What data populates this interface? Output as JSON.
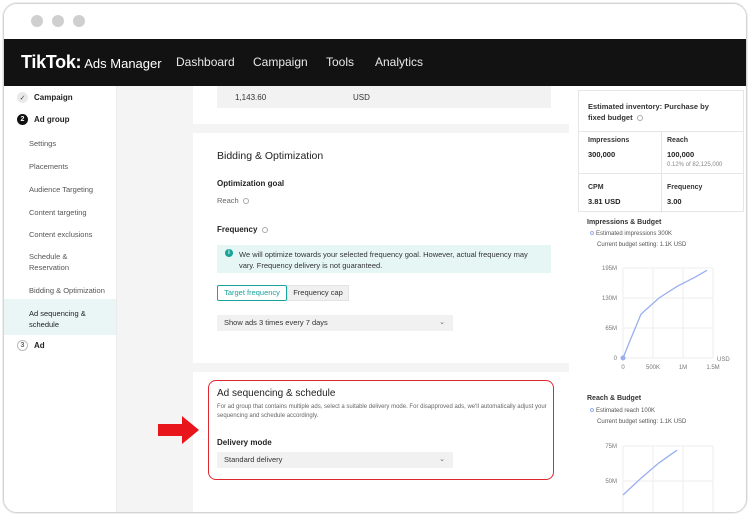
{
  "browser": {
    "dots": [
      "close",
      "minimize",
      "maximize"
    ]
  },
  "topnav": {
    "logo": "TikTok:",
    "logo_sub": "Ads Manager",
    "links": [
      "Dashboard",
      "Campaign",
      "Tools",
      "Analytics"
    ]
  },
  "sidebar": {
    "steps": [
      {
        "badge": "✓",
        "label": "Campaign",
        "state": "done"
      },
      {
        "badge": "2",
        "label": "Ad group",
        "state": "active"
      },
      {
        "badge": "3",
        "label": "Ad",
        "state": "todo"
      }
    ],
    "items": [
      "Settings",
      "Placements",
      "Audience Targeting",
      "Content targeting",
      "Content exclusions",
      "Schedule & Reservation",
      "Bidding & Optimization",
      "Ad sequencing & schedule"
    ]
  },
  "budget": {
    "value": "1,143.60",
    "currency": "USD"
  },
  "bidding": {
    "title": "Bidding & Optimization",
    "goal_label": "Optimization goal",
    "goal_value": "Reach",
    "freq_label": "Frequency",
    "info_icon": "i",
    "info_text": "We will optimize towards your selected frequency goal. However, actual frequency may vary. Frequency delivery is not guaranteed.",
    "tabs": [
      "Target frequency",
      "Frequency cap"
    ],
    "select_value": "Show ads 3 times every 7 days"
  },
  "sequencing": {
    "title": "Ad sequencing & schedule",
    "desc": "For ad group that contains multiple ads, select a suitable delivery mode. For disapproved ads, we'll automatically adjust your sequencing and schedule accordingly.",
    "mode_label": "Delivery mode",
    "mode_value": "Standard delivery"
  },
  "right_panel": {
    "header": "Estimated inventory: Purchase by fixed budget",
    "metrics": [
      {
        "label": "Impressions",
        "value": "300,000",
        "sub": ""
      },
      {
        "label": "Reach",
        "value": "100,000",
        "sub": "0.12% of 82,125,000"
      },
      {
        "label": "CPM",
        "value": "3.81 USD",
        "sub": ""
      },
      {
        "label": "Frequency",
        "value": "3.00",
        "sub": ""
      }
    ],
    "chart1": {
      "title": "Impressions & Budget",
      "legend": "Estimated impressions 300K",
      "budget_note": "Current budget setting: 1.1K USD",
      "unit": "USD"
    },
    "chart2": {
      "title": "Reach & Budget",
      "legend": "Estimated reach 100K",
      "budget_note": "Current budget setting: 1.1K USD"
    }
  },
  "chart_data": [
    {
      "type": "line",
      "title": "Impressions & Budget",
      "x_ticks": [
        "0",
        "500K",
        "1M",
        "1.5M"
      ],
      "y_ticks": [
        "0",
        "65M",
        "130M",
        "195M"
      ],
      "xlabel": "USD",
      "x": [
        0,
        125000,
        300000,
        600000,
        900000,
        1200000,
        1400000
      ],
      "y": [
        0,
        40,
        95,
        130,
        155,
        175,
        190
      ],
      "color": "#9aaef0"
    },
    {
      "type": "line",
      "title": "Reach & Budget",
      "y_ticks": [
        "50M",
        "75M"
      ],
      "x": [
        0,
        300000,
        600000,
        900000
      ],
      "y": [
        40,
        52,
        63,
        72
      ],
      "color": "#9aaef0"
    }
  ],
  "colors": {
    "accent": "#1aa39a",
    "highlight": "#e0262f",
    "arrow": "#e8161a",
    "line": "#9aaef0"
  }
}
